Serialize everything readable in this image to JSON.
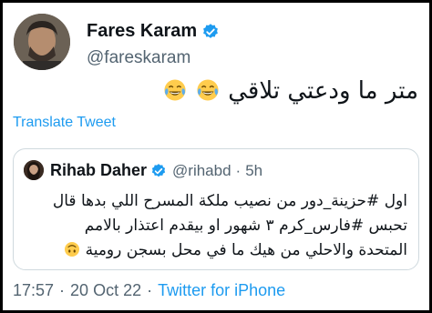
{
  "author": {
    "name": "Fares Karam",
    "handle": "@fareskaram",
    "verified": true,
    "avatar_icon": "profile-photo"
  },
  "tweet": {
    "text": "متر ما ودعتي تلاقي",
    "emojis": [
      "face-with-tears-of-joy",
      "face-with-tears-of-joy"
    ]
  },
  "translate_label": "Translate Tweet",
  "quoted_tweet": {
    "name": "Rihab Daher",
    "handle": "@rihabd",
    "separator": "·",
    "time": "5h",
    "verified": true,
    "lines": [
      "اول #حزينة_دور من نصيب ملكة المسرح اللي بدها قال",
      "تحبس #فارس_كرم ٣ شهور  او بيقدم اعتذار بالامم",
      "المتحدة  والاحلي من هيك ما في محل بسجن رومية"
    ],
    "end_emoji": "upside-down-face"
  },
  "meta": {
    "time": "17:57",
    "separator": "·",
    "date": "20 Oct 22",
    "source": "Twitter for iPhone"
  },
  "colors": {
    "link": "#1d9bf0",
    "secondary_text": "#536471",
    "border": "#cfd9de",
    "verified": "#1d9bf0"
  }
}
